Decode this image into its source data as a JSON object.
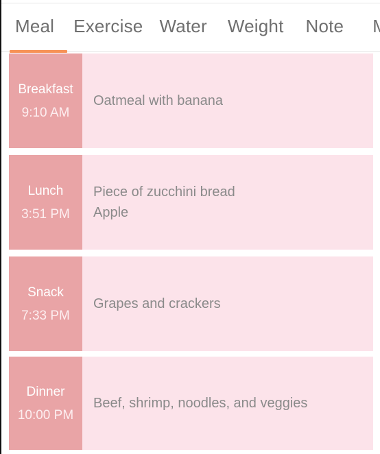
{
  "theme": {
    "accent": "#f79256",
    "label_block": "#e9a4a6",
    "row_background": "#fce3ea",
    "tab_text": "#6f6f6f",
    "body_text": "#8a8a8a",
    "divider": "#e8e8e8"
  },
  "tabs": {
    "active_index": 0,
    "items": [
      {
        "label": "Meal"
      },
      {
        "label": "Exercise"
      },
      {
        "label": "Water"
      },
      {
        "label": "Weight"
      },
      {
        "label": "Note"
      },
      {
        "label": "Meds"
      }
    ]
  },
  "meals": [
    {
      "name": "Breakfast",
      "time": "9:10 AM",
      "items": [
        "Oatmeal with banana"
      ]
    },
    {
      "name": "Lunch",
      "time": "3:51 PM",
      "items": [
        "Piece of zucchini bread",
        "Apple"
      ]
    },
    {
      "name": "Snack",
      "time": "7:33 PM",
      "items": [
        "Grapes and crackers"
      ]
    },
    {
      "name": "Dinner",
      "time": "10:00 PM",
      "items": [
        "Beef, shrimp, noodles, and veggies"
      ]
    }
  ]
}
